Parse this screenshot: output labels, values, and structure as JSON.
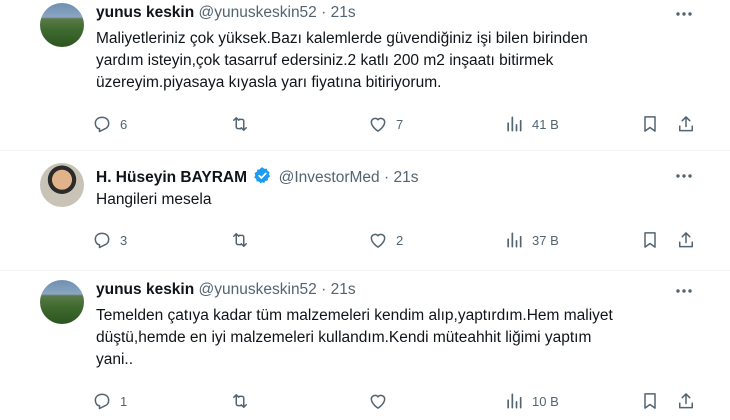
{
  "tweets": [
    {
      "name": "yunus keskin",
      "handle": "@yunuskeskin52",
      "time": "· 21s",
      "verified": false,
      "text_lines": [
        "Maliyetleriniz çok yüksek.Bazı kalemlerde güvendiğiniz işi bilen birinden",
        "yardım isteyin,çok tasarruf edersiniz.2 katlı 200 m2 inşaatı bitirmek",
        "üzereyim.piyasaya kıyasla yarı fiyatına bitiriyorum."
      ],
      "replies": "6",
      "retweets": "",
      "likes": "7",
      "views": "41 B"
    },
    {
      "name": "H. Hüseyin BAYRAM",
      "handle": "@InvestorMed",
      "time": "· 21s",
      "verified": true,
      "text_lines": [
        "Hangileri mesela"
      ],
      "replies": "3",
      "retweets": "",
      "likes": "2",
      "views": "37 B"
    },
    {
      "name": "yunus keskin",
      "handle": "@yunuskeskin52",
      "time": "· 21s",
      "verified": false,
      "text_lines": [
        "Temelden çatıya kadar tüm malzemeleri kendim alıp,yaptırdım.Hem maliyet",
        "düştü,hemde en iyi malzemeleri kullandım.Kendi müteahhit liğimi yaptım",
        "yani.."
      ],
      "replies": "1",
      "retweets": "",
      "likes": "",
      "views": "10 B"
    }
  ],
  "colors": {
    "accent": "#1d9bf0",
    "muted": "#536471",
    "text": "#0f1419"
  }
}
